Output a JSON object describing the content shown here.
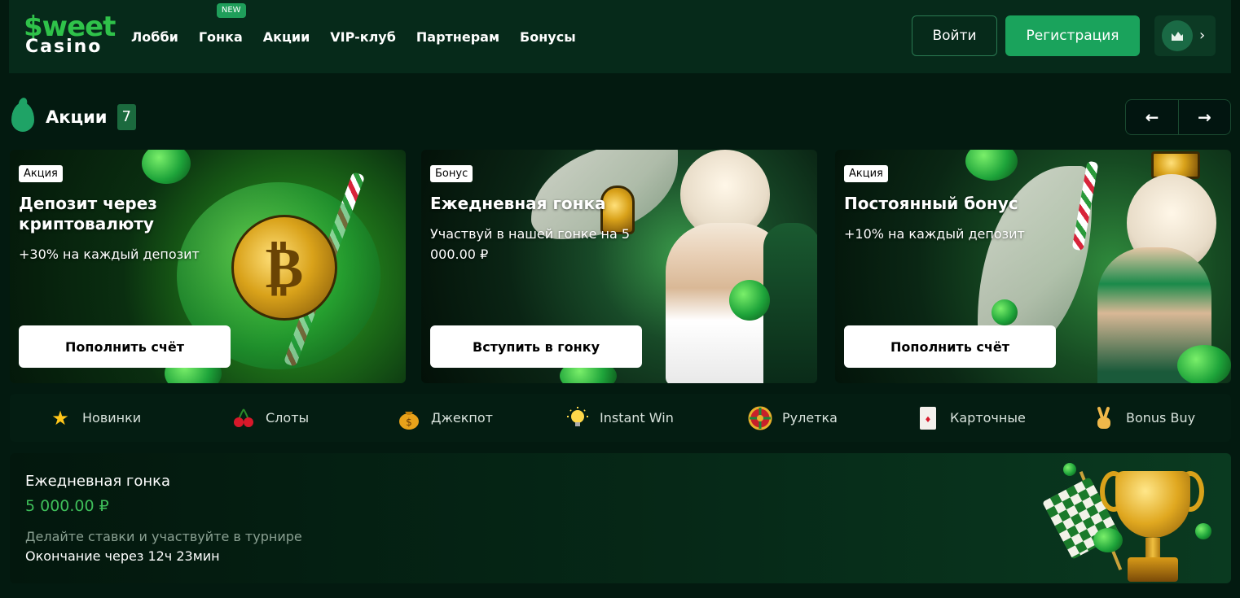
{
  "header": {
    "logo": {
      "line1": "$weet",
      "line2": "Casino"
    },
    "nav": [
      {
        "label": "Лобби"
      },
      {
        "label": "Гонка",
        "badge": "NEW"
      },
      {
        "label": "Акции"
      },
      {
        "label": "VIP-клуб"
      },
      {
        "label": "Партнерам"
      },
      {
        "label": "Бонусы"
      }
    ],
    "login_label": "Войти",
    "register_label": "Регистрация",
    "user_chevron": "›"
  },
  "promos_section": {
    "title": "Акции",
    "count": "7",
    "prev": "←",
    "next": "→"
  },
  "promos": [
    {
      "tag": "Акция",
      "title": "Депозит через криптовалюту",
      "desc": "+30% на каждый депозит",
      "button": "Пополнить счёт"
    },
    {
      "tag": "Бонус",
      "title": "Ежедневная гонка",
      "desc": "Участвуй в нашей гонке на 5 000.00 ₽",
      "button": "Вступить в гонку"
    },
    {
      "tag": "Акция",
      "title": "Постоянный бонус",
      "desc": "+10% на каждый депозит",
      "button": "Пополнить счёт"
    }
  ],
  "categories": [
    {
      "label": "Новинки",
      "icon": "star-icon"
    },
    {
      "label": "Слоты",
      "icon": "cherries-icon"
    },
    {
      "label": "Джекпот",
      "icon": "money-bag-icon"
    },
    {
      "label": "Instant Win",
      "icon": "lightbulb-icon"
    },
    {
      "label": "Рулетка",
      "icon": "roulette-icon"
    },
    {
      "label": "Карточные",
      "icon": "playing-card-icon"
    },
    {
      "label": "Bonus Buy",
      "icon": "victory-hand-icon"
    }
  ],
  "race": {
    "title": "Ежедневная гонка",
    "amount": "5 000.00 ₽",
    "subtitle": "Делайте ставки и участвуйте в турнире",
    "ends": "Окончание через 12ч 23мин"
  },
  "colors": {
    "accent": "#1aa35c",
    "background": "#031a10",
    "amount": "#3fbf5a"
  }
}
